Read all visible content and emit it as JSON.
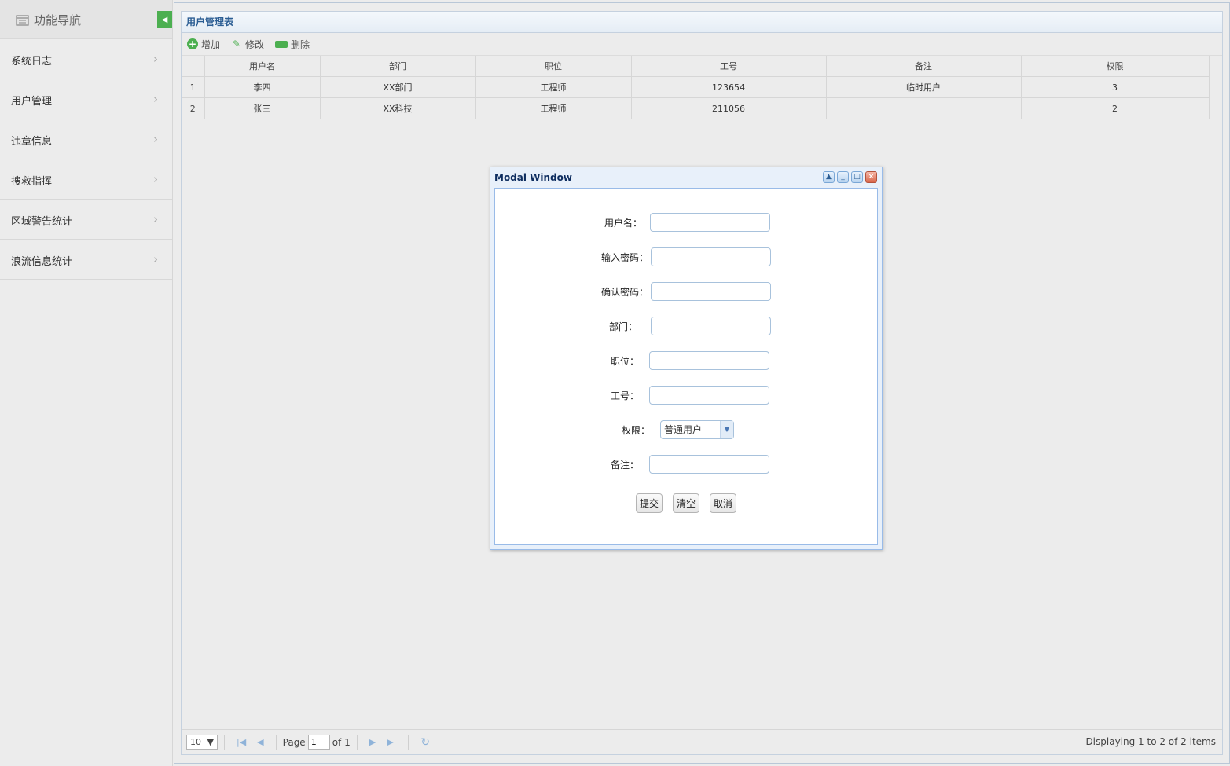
{
  "sidebar": {
    "title": "功能导航",
    "toggle_icon": "collapse-left-icon",
    "items": [
      {
        "label": "系统日志"
      },
      {
        "label": "用户管理"
      },
      {
        "label": "违章信息"
      },
      {
        "label": "搜救指挥"
      },
      {
        "label": "区域警告统计"
      },
      {
        "label": "浪流信息统计"
      }
    ]
  },
  "panel": {
    "title": "用户管理表",
    "toolbar": {
      "add_label": "增加",
      "edit_label": "修改",
      "delete_label": "删除"
    }
  },
  "grid": {
    "columns": [
      "用户名",
      "部门",
      "职位",
      "工号",
      "备注",
      "权限"
    ],
    "rows": [
      {
        "num": "1",
        "username": "李四",
        "dept": "XX部门",
        "position": "工程师",
        "empno": "123654",
        "remark": "临时用户",
        "perm": "3"
      },
      {
        "num": "2",
        "username": "张三",
        "dept": "XX科技",
        "position": "工程师",
        "empno": "211056",
        "remark": "",
        "perm": "2"
      }
    ]
  },
  "pager": {
    "page_size": "10",
    "page_label": "Page",
    "page_value": "1",
    "of_label": "of 1",
    "info": "Displaying 1 to 2 of 2 items"
  },
  "modal": {
    "title": "Modal Window",
    "fields": {
      "username": "用户名：",
      "password": "输入密码：",
      "confirm": "确认密码：",
      "dept": "部门：",
      "position": "职位：",
      "empno": "工号：",
      "permission": "权限：",
      "remark": "备注："
    },
    "permission_selected": "普通用户",
    "buttons": {
      "submit": "提交",
      "clear": "清空",
      "cancel": "取消"
    }
  },
  "colors": {
    "accent_green": "#4caf50",
    "title_blue": "#2b5d93",
    "modal_border": "#99bbe8"
  }
}
